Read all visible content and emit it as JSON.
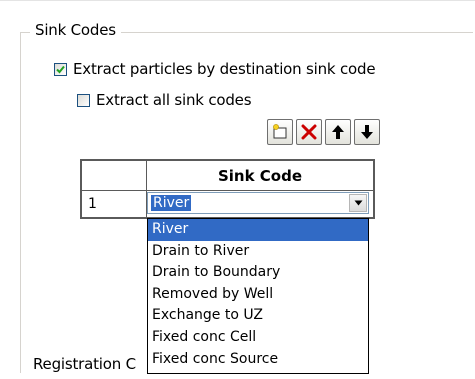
{
  "group_title": "Sink Codes",
  "extract_by_sink_code": {
    "label": "Extract particles by destination sink code",
    "checked": true
  },
  "extract_all_sink_codes": {
    "label": "Extract all sink codes",
    "checked": false
  },
  "toolbar": {
    "icons": [
      "new-row-icon",
      "delete-icon",
      "move-up-icon",
      "move-down-icon"
    ],
    "delete_color": "#cc0000"
  },
  "grid": {
    "column_header": "Sink Code",
    "rows": [
      {
        "row_number": "1",
        "sink_code": "River"
      }
    ]
  },
  "dropdown": {
    "options": [
      "River",
      "Drain to River",
      "Drain to Boundary",
      "Removed by Well",
      "Exchange to UZ",
      "Fixed conc Cell",
      "Fixed conc Source"
    ],
    "selected_index": 0,
    "highlight_color": "#316ac5"
  },
  "next_group_title": "Registration C"
}
